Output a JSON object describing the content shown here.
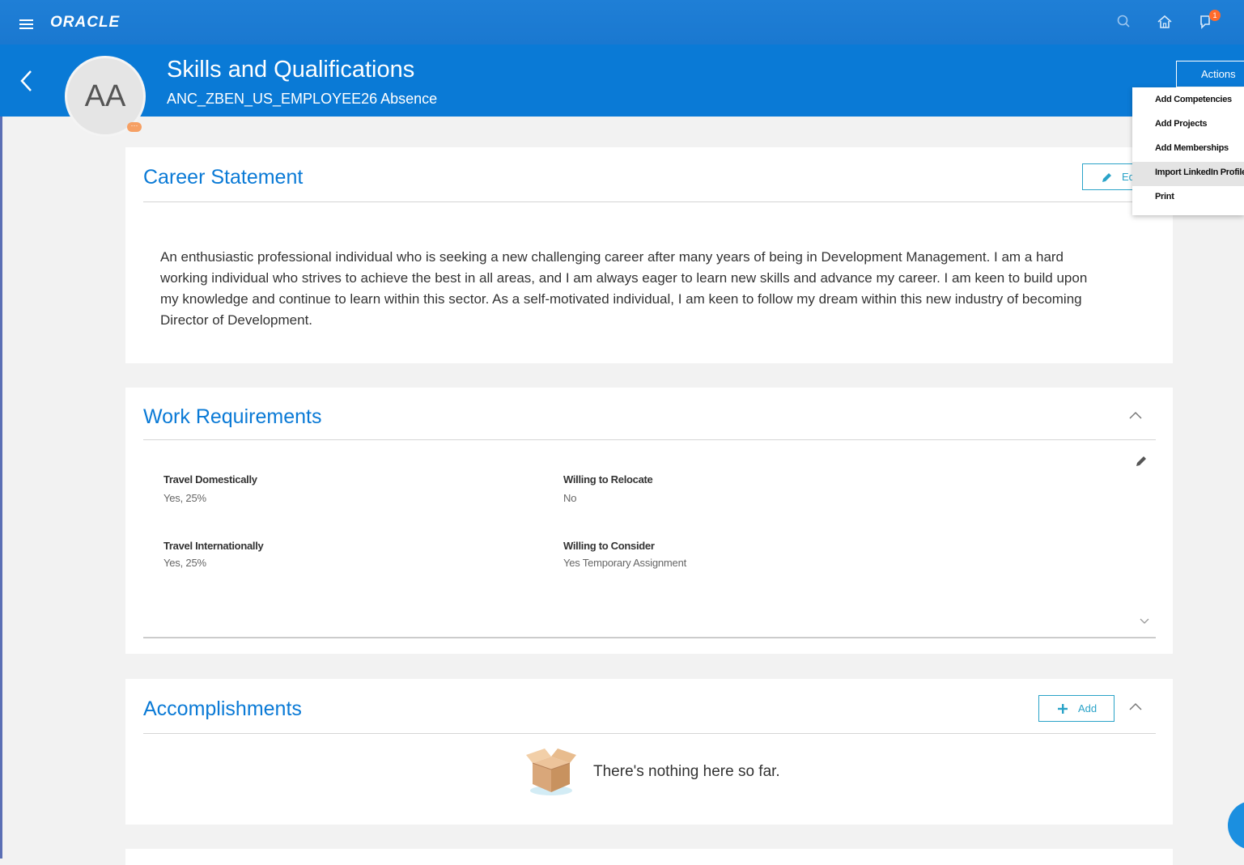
{
  "topbar": {
    "logo": "ORACLE",
    "notification_count": "1"
  },
  "header": {
    "avatar_initials": "AA",
    "title": "Skills and Qualifications",
    "subtitle": "ANC_ZBEN_US_EMPLOYEE26 Absence",
    "actions_label": "Actions",
    "actions_menu": [
      "Add Competencies",
      "Add Projects",
      "Add Memberships",
      "Import LinkedIn Profile",
      "Print"
    ]
  },
  "career": {
    "title": "Career Statement",
    "edit_label": "Ed",
    "statement": "An enthusiastic professional individual who is seeking a new challenging career after many years of being in Development Management. I am a hard working individual who strives to achieve the best in all areas, and I am always eager to learn new skills and advance my career. I am keen to build upon my knowledge and continue to learn within this sector. As a self-motivated individual, I am keen to follow my dream within this new industry of becoming Director of Development."
  },
  "work": {
    "title": "Work Requirements",
    "fields": [
      {
        "label": "Travel Domestically",
        "value": "Yes, 25%"
      },
      {
        "label": "Willing to Relocate",
        "value": "No"
      },
      {
        "label": "Travel Internationally",
        "value": "Yes, 25%"
      },
      {
        "label": "Willing to Consider",
        "value": "Yes Temporary Assignment"
      }
    ]
  },
  "accomplishments": {
    "title": "Accomplishments",
    "add_label": "Add",
    "empty_text": "There's nothing here so far."
  },
  "colors": {
    "brand_blue": "#0a7ad6",
    "teal_button": "#2aa3c8",
    "notification": "#ff6b2c"
  }
}
